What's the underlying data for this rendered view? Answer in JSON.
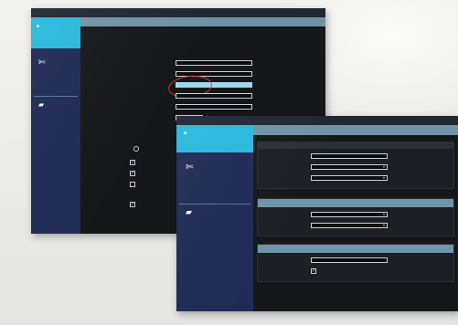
{
  "colors": {
    "accent": "#28b8dd",
    "sidebar": "#1f2a55",
    "page_bar": "#6f93a6",
    "section_bar": "#7095a8",
    "field_highlight": "#9fd9ec",
    "annotation_ring": "#d23a2c"
  },
  "icons": {
    "brand": "brand-logo-icon",
    "tools": "tools-icon",
    "user": "user-icon",
    "dropdown": "chevron-down-icon",
    "check": "checkmark-icon"
  },
  "back_window": {
    "tabs": [
      "",
      "",
      "",
      ""
    ],
    "sidebar": {
      "brand_title": "",
      "brand_subtitle": "",
      "section_1": {
        "title": "",
        "links": [
          "",
          "",
          ""
        ]
      },
      "section_2": {
        "title": "",
        "links": [
          "",
          "",
          ""
        ]
      }
    },
    "page_title": "",
    "form_rows": [
      {
        "label": "",
        "value": ""
      },
      {
        "label": "",
        "value": ""
      },
      {
        "label": "",
        "value": ""
      },
      {
        "label": "",
        "value": ""
      },
      {
        "label": "",
        "value": ""
      },
      {
        "label": "",
        "value": ""
      }
    ],
    "extra_labels": [
      "",
      ""
    ],
    "radio_label": "",
    "checkboxes": [
      {
        "label": "",
        "checked": true
      },
      {
        "label": "",
        "checked": true
      },
      {
        "label": "",
        "checked": false
      },
      {
        "label": "",
        "checked": true
      }
    ]
  },
  "front_window": {
    "tabs": [
      "",
      "",
      ""
    ],
    "sidebar": {
      "brand_title": "",
      "brand_subtitle": "",
      "section_1": {
        "title": "",
        "links": [
          "",
          "",
          "",
          ""
        ]
      },
      "section_2": {
        "title": "",
        "links": [
          "",
          "",
          ""
        ]
      }
    },
    "page_title": "",
    "section_1": {
      "rows": [
        {
          "label": "",
          "value": ""
        },
        {
          "label": "",
          "value": ""
        },
        {
          "label": "",
          "value": ""
        }
      ]
    },
    "section_2": {
      "title": "",
      "rows": [
        {
          "label": "",
          "value": ""
        },
        {
          "label": "",
          "value": ""
        }
      ]
    },
    "section_3": {
      "title": "",
      "rows": [
        {
          "label": "",
          "value": ""
        }
      ],
      "checkbox": {
        "label": "",
        "checked": true
      }
    }
  }
}
